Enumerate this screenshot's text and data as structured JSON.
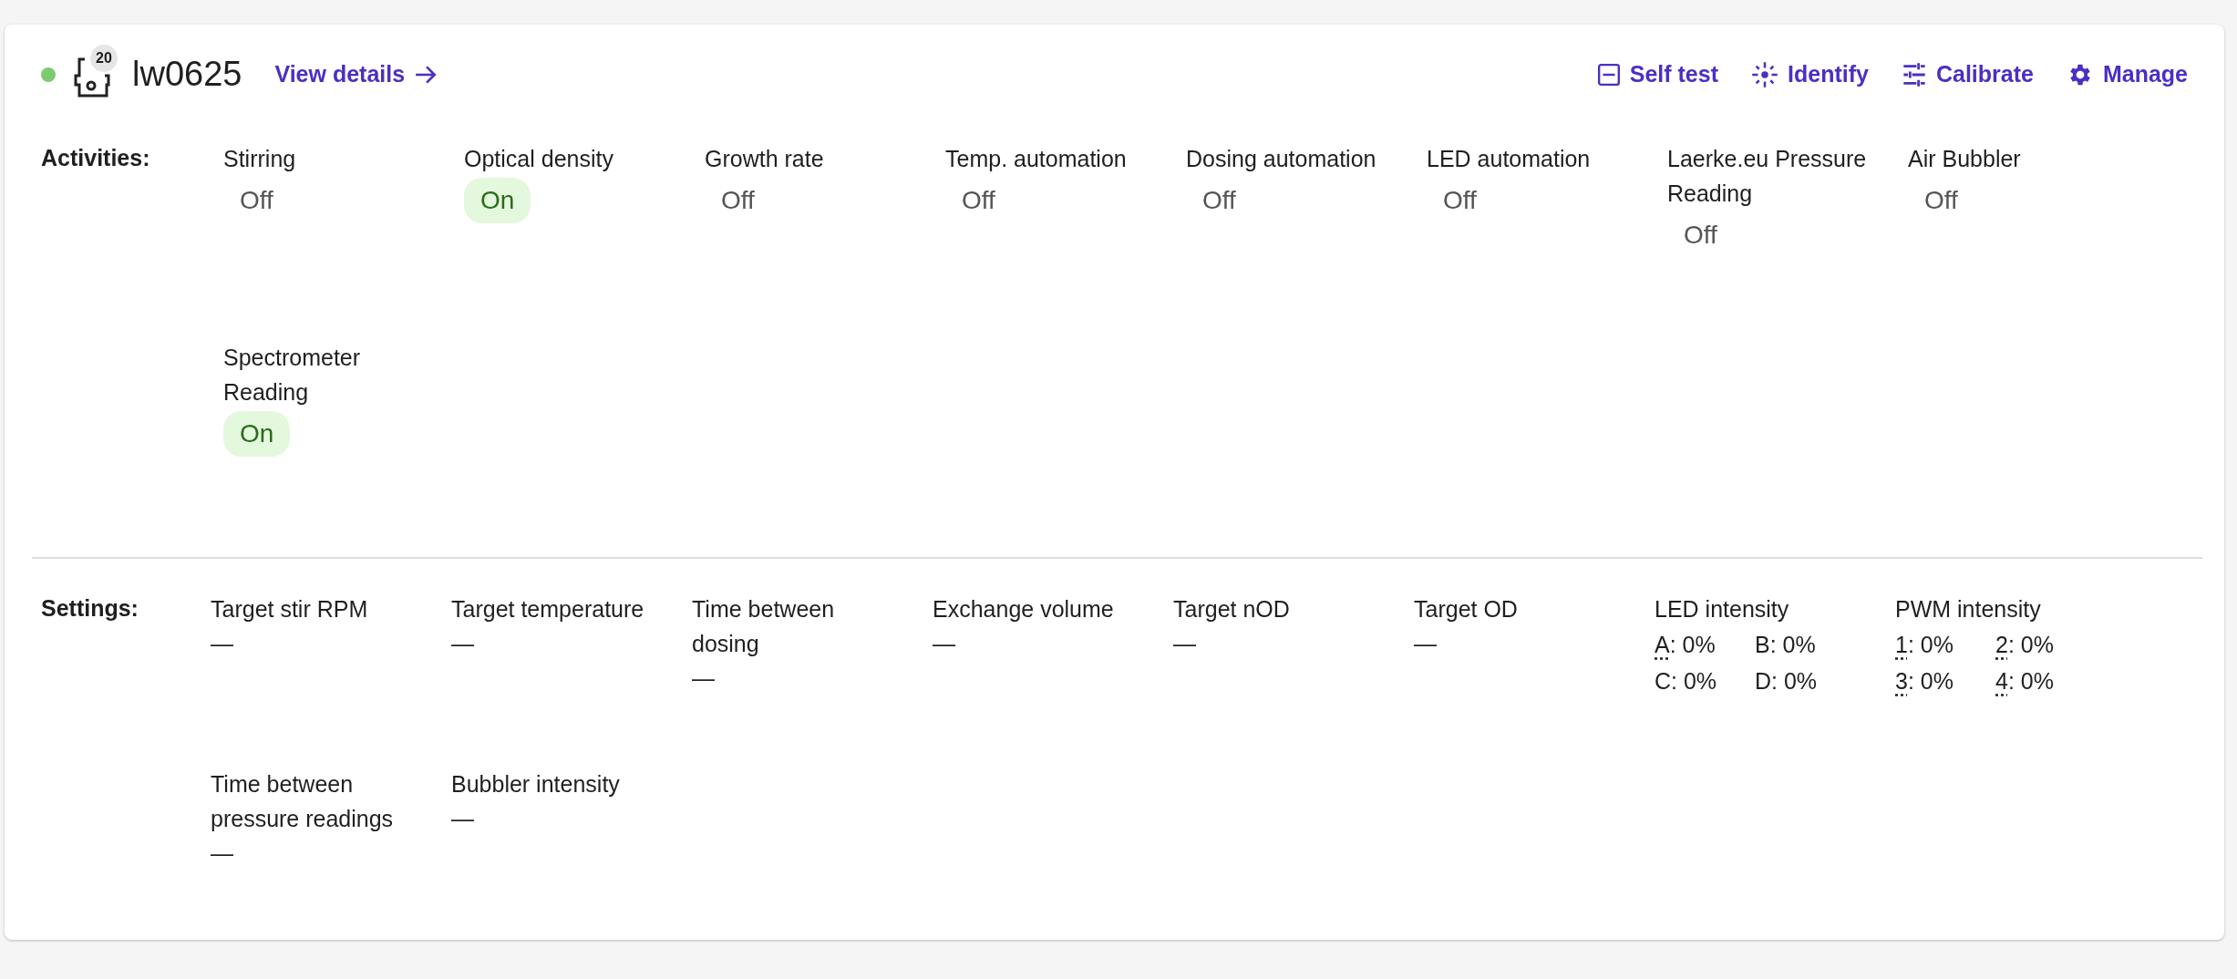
{
  "unit": {
    "name": "lw0625",
    "online": true,
    "badge": "20",
    "details_link": "View details"
  },
  "actions": [
    {
      "kind": "selftest",
      "label": "Self test"
    },
    {
      "kind": "identify",
      "label": "Identify"
    },
    {
      "kind": "calibrate",
      "label": "Calibrate"
    },
    {
      "kind": "manage",
      "label": "Manage"
    }
  ],
  "activities": {
    "label": "Activities:",
    "items": [
      {
        "name": "Stirring",
        "status": "Off",
        "active": false
      },
      {
        "name": "Optical density",
        "status": "On",
        "active": true
      },
      {
        "name": "Growth rate",
        "status": "Off",
        "active": false
      },
      {
        "name": "Temp. automation",
        "status": "Off",
        "active": false
      },
      {
        "name": "Dosing automation",
        "status": "Off",
        "active": false
      },
      {
        "name": "LED automation",
        "status": "Off",
        "active": false
      },
      {
        "name": "Laerke.eu Pressure Reading",
        "status": "Off",
        "active": false
      },
      {
        "name": "Air Bubbler",
        "status": "Off",
        "active": false
      },
      {
        "name": "Spectrometer Reading",
        "status": "On",
        "active": true
      }
    ]
  },
  "settings": {
    "label": "Settings:",
    "items": [
      {
        "kind": "value",
        "name": "Target stir RPM",
        "value": "—"
      },
      {
        "kind": "value",
        "name": "Target temperature",
        "value": "—"
      },
      {
        "kind": "value",
        "name": "Time between dosing",
        "value": "—"
      },
      {
        "kind": "value",
        "name": "Exchange volume",
        "value": "—"
      },
      {
        "kind": "value",
        "name": "Target nOD",
        "value": "—"
      },
      {
        "kind": "value",
        "name": "Target OD",
        "value": "—"
      },
      {
        "kind": "channels",
        "name": "LED intensity",
        "channels": [
          {
            "channel": "A",
            "value": ": 0%",
            "dotted": true
          },
          {
            "channel": "B",
            "value": ": 0%",
            "dotted": false
          },
          {
            "channel": "C",
            "value": ": 0%",
            "dotted": false
          },
          {
            "channel": "D",
            "value": ": 0%",
            "dotted": false
          }
        ]
      },
      {
        "kind": "channels",
        "name": "PWM intensity",
        "channels": [
          {
            "channel": "1",
            "value": ": 0%",
            "dotted": true
          },
          {
            "channel": "2",
            "value": ": 0%",
            "dotted": true
          },
          {
            "channel": "3",
            "value": ": 0%",
            "dotted": true
          },
          {
            "channel": "4",
            "value": ": 0%",
            "dotted": true
          }
        ]
      },
      {
        "kind": "value",
        "name": "Time between pressure readings",
        "value": "—"
      },
      {
        "kind": "value",
        "name": "Bubbler intensity",
        "value": "—"
      }
    ]
  }
}
